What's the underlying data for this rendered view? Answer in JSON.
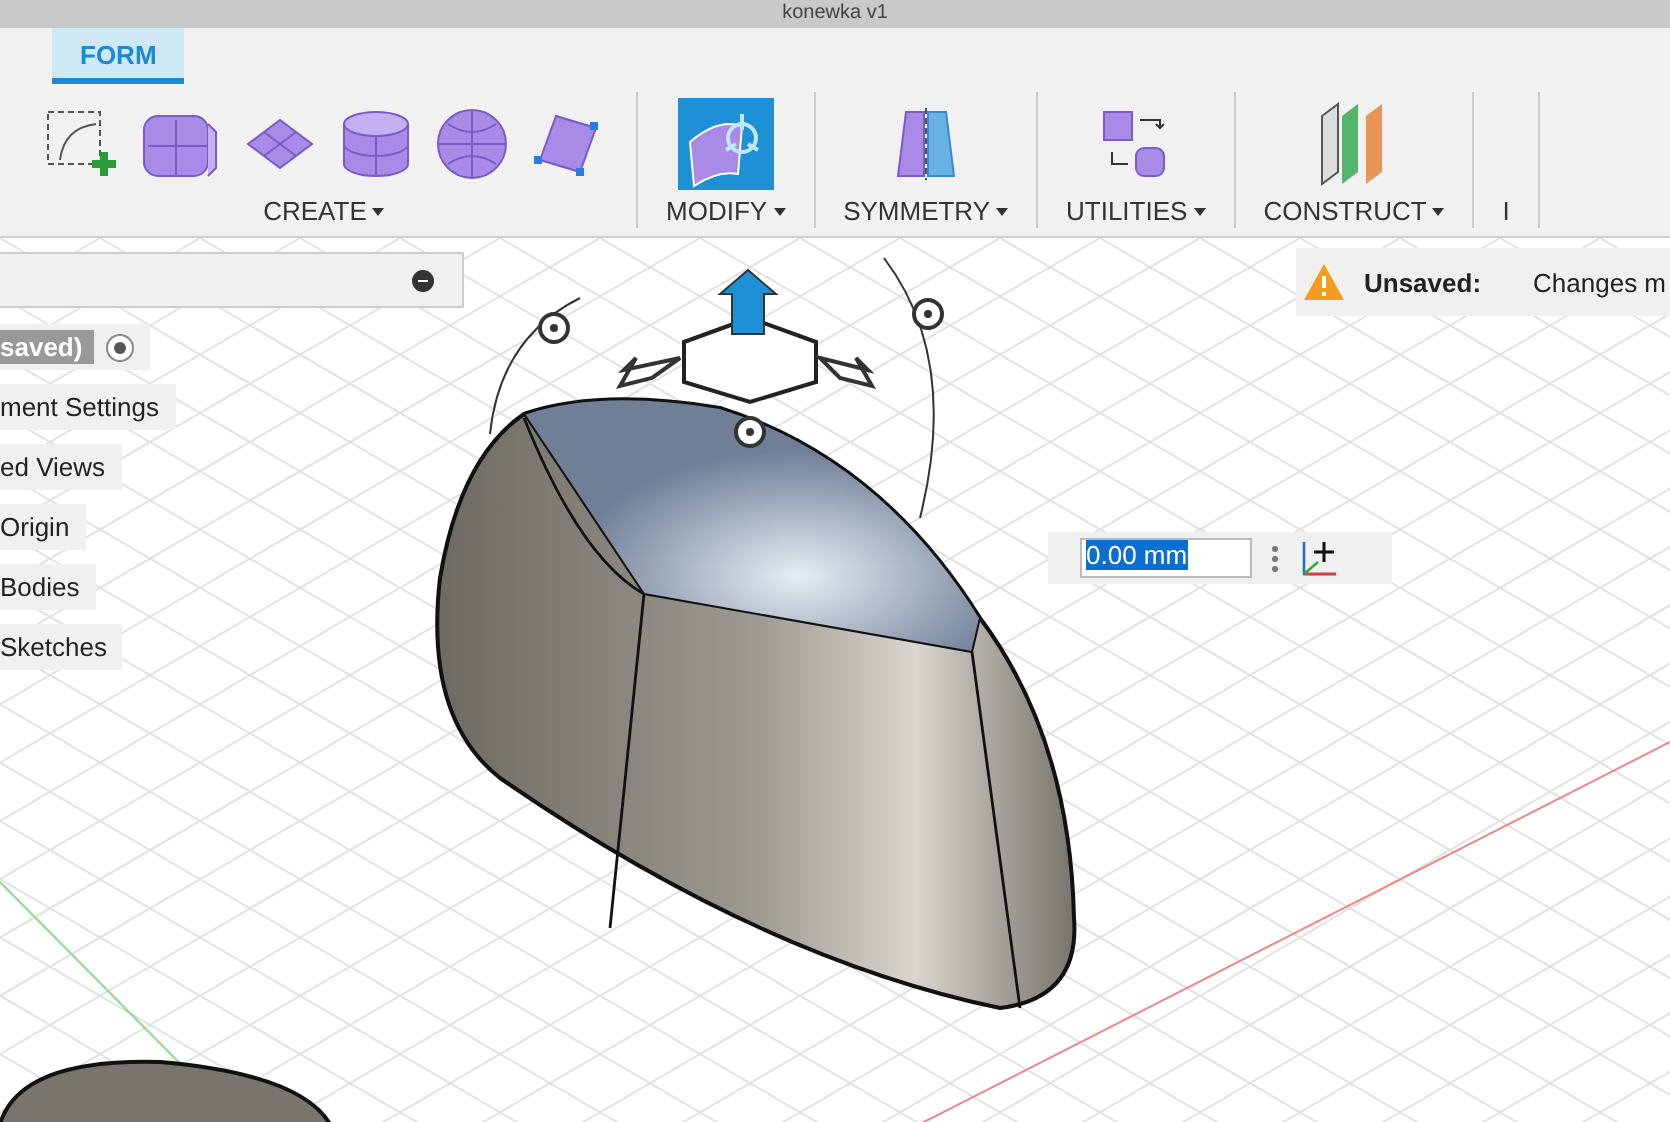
{
  "document_tab": {
    "title": "konewka v1"
  },
  "tabs": [
    {
      "label": "FORM",
      "selected": true
    }
  ],
  "groups": [
    {
      "label": "CREATE",
      "tools": [
        {
          "kind": "sketch"
        },
        {
          "kind": "box"
        },
        {
          "kind": "plane"
        },
        {
          "kind": "cylinder"
        },
        {
          "kind": "sphere"
        },
        {
          "kind": "quadball"
        }
      ]
    },
    {
      "label": "MODIFY",
      "tools": [
        {
          "kind": "edit-form"
        }
      ]
    },
    {
      "label": "SYMMETRY",
      "tools": [
        {
          "kind": "mirror"
        }
      ]
    },
    {
      "label": "UTILITIES",
      "tools": [
        {
          "kind": "convert"
        }
      ]
    },
    {
      "label": "CONSTRUCT",
      "tools": [
        {
          "kind": "planes"
        }
      ]
    },
    {
      "label": "I"
    }
  ],
  "browser": {
    "items": [
      {
        "label": "saved)",
        "kind": "root"
      },
      {
        "label": "ment Settings",
        "kind": "node"
      },
      {
        "label": "ed Views",
        "kind": "node"
      },
      {
        "label": "Origin",
        "kind": "node"
      },
      {
        "label": "Bodies",
        "kind": "node"
      },
      {
        "label": "Sketches",
        "kind": "node"
      }
    ]
  },
  "notice": {
    "label": "Unsaved:",
    "message": "Changes m"
  },
  "distance_input": {
    "value": "0.00 mm"
  }
}
